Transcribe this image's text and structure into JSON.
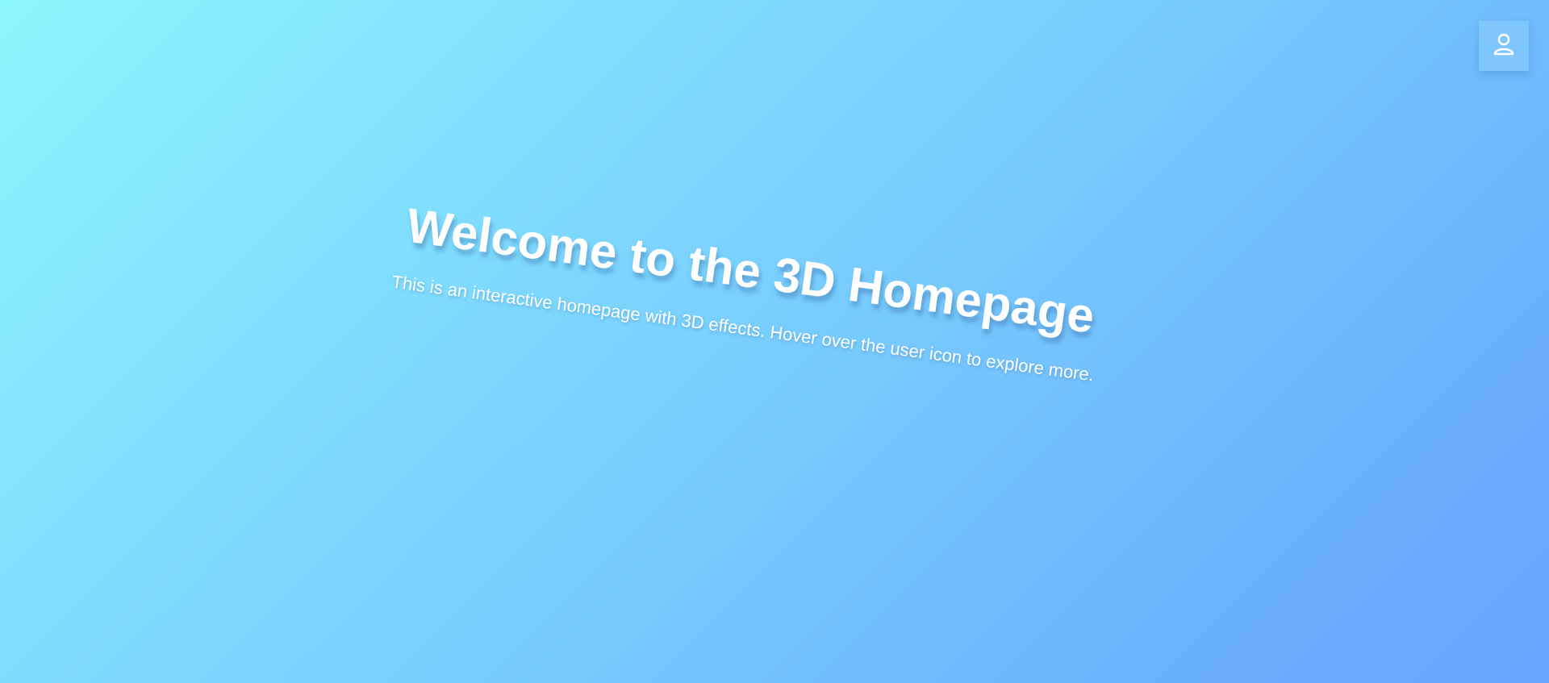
{
  "header": {
    "user_icon": "user-icon"
  },
  "hero": {
    "title": "Welcome to the 3D Homepage",
    "subtitle": "This is an interactive homepage with 3D effects. Hover over the user icon to explore more."
  },
  "colors": {
    "gradient_start": "#8cf6fd",
    "gradient_end": "#67a6fd",
    "text": "#ffffff"
  }
}
